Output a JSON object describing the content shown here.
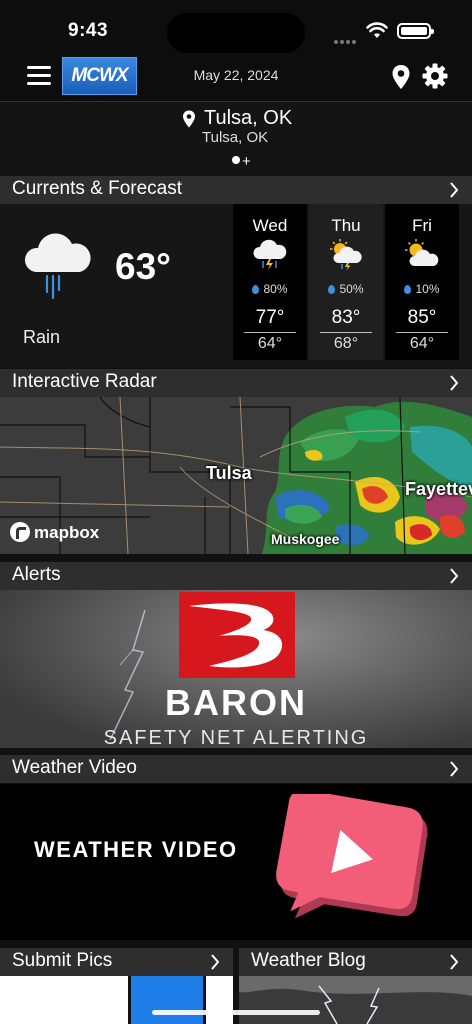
{
  "status_bar": {
    "time": "9:43"
  },
  "header": {
    "logo_text": "MCWX",
    "date": "May 22, 2024"
  },
  "location": {
    "title": "Tulsa, OK",
    "subtitle": "Tulsa, OK",
    "add_symbol": "+"
  },
  "sections": {
    "currents": "Currents & Forecast",
    "radar": "Interactive Radar",
    "alerts": "Alerts",
    "video": "Weather Video",
    "submit_pics": "Submit Pics",
    "blog": "Weather Blog"
  },
  "current": {
    "temp": "63°",
    "condition": "Rain",
    "icon": "rain-cloud-icon"
  },
  "forecast": [
    {
      "day": "Wed",
      "pop": "80%",
      "high": "77°",
      "low": "64°",
      "icon": "thunderstorm-icon"
    },
    {
      "day": "Thu",
      "pop": "50%",
      "high": "83°",
      "low": "68°",
      "icon": "partly-sunny-storm-icon"
    },
    {
      "day": "Fri",
      "pop": "10%",
      "high": "85°",
      "low": "64°",
      "icon": "partly-sunny-icon"
    }
  ],
  "radar": {
    "cities": [
      "Tulsa",
      "Muskogee",
      "Fayetteville"
    ],
    "attribution": "mapbox"
  },
  "alerts_promo": {
    "brand": "BARON",
    "tagline": "SAFETY NET ALERTING"
  },
  "video_promo": {
    "text": "WEATHER VIDEO"
  },
  "colors": {
    "accent_blue": "#1a5fb8",
    "baron_red": "#d6171e",
    "play_pink": "#f25d78",
    "rain_drop": "#3d8fe6"
  }
}
